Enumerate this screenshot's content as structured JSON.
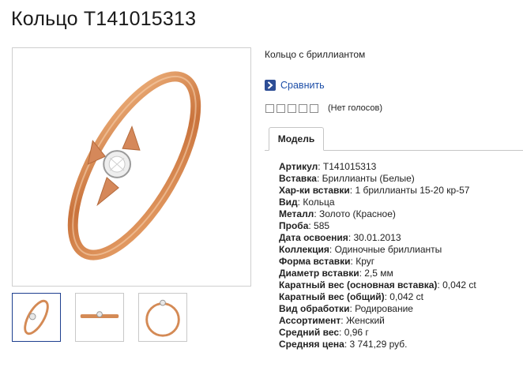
{
  "title": "Кольцо Т141015313",
  "subtitle": "Кольцо с бриллиантом",
  "compare": {
    "label": "Сравнить",
    "icon": "chevron-right-icon"
  },
  "rating": {
    "stars_total": 5,
    "stars_filled": 0,
    "votes_text": "(Нет голосов)"
  },
  "tabs": [
    {
      "label": "Модель",
      "active": true
    }
  ],
  "thumbnails": [
    {
      "view": "front",
      "selected": true
    },
    {
      "view": "side",
      "selected": false
    },
    {
      "view": "top",
      "selected": false
    }
  ],
  "properties": [
    {
      "label": "Артикул",
      "value": "Т141015313"
    },
    {
      "label": "Вставка",
      "value": "Бриллианты (Белые)"
    },
    {
      "label": "Хар-ки вставки",
      "value": "1 бриллианты 15-20 кр-57"
    },
    {
      "label": "Вид",
      "value": "Кольца"
    },
    {
      "label": "Металл",
      "value": "Золото (Красное)"
    },
    {
      "label": "Проба",
      "value": "585"
    },
    {
      "label": "Дата освоения",
      "value": "30.01.2013"
    },
    {
      "label": "Коллекция",
      "value": "Одиночные бриллианты"
    },
    {
      "label": "Форма вставки",
      "value": "Круг"
    },
    {
      "label": "Диаметр вставки",
      "value": "2,5 мм"
    },
    {
      "label": "Каратный вес (основная вставка)",
      "value": "0,042 ct"
    },
    {
      "label": "Каратный вес (общий)",
      "value": "0,042 ct"
    },
    {
      "label": "Вид обработки",
      "value": "Родирование"
    },
    {
      "label": "Ассортимент",
      "value": "Женский"
    },
    {
      "label": "Средний вес",
      "value": "0,96 г"
    },
    {
      "label": "Средняя цена",
      "value": "3 741,29 руб."
    }
  ],
  "colors": {
    "gold": "#d98d55",
    "accent": "#1e4fa8",
    "icon_bg": "#2d4d95"
  }
}
